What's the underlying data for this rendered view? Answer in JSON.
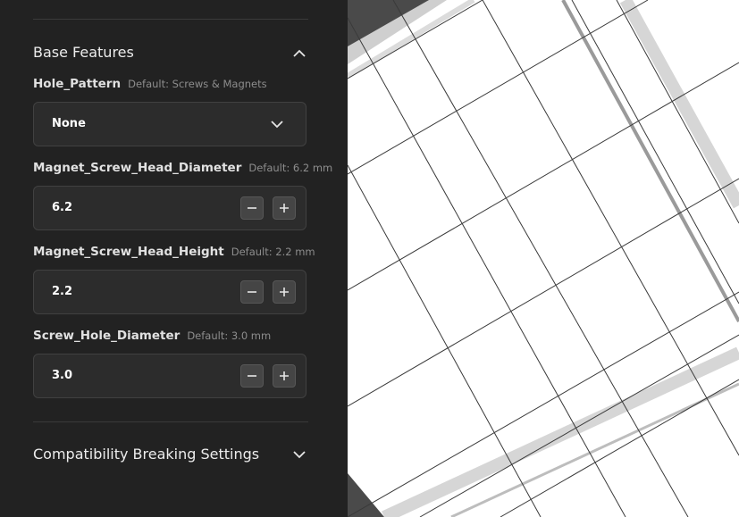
{
  "sections": {
    "base_features": {
      "title": "Base Features",
      "icon": "chevron-up-icon"
    },
    "compat": {
      "title": "Compatibility Breaking Settings",
      "icon": "chevron-down-icon"
    }
  },
  "params": {
    "hole_pattern": {
      "label": "Hole_Pattern",
      "default": "Default: Screws & Magnets",
      "value": "None",
      "icon": "chevron-down-icon"
    },
    "head_diameter": {
      "label": "Magnet_Screw_Head_Diameter",
      "default": "Default: 6.2 mm",
      "value": "6.2"
    },
    "head_height": {
      "label": "Magnet_Screw_Head_Height",
      "default": "Default: 2.2 mm",
      "value": "2.2"
    },
    "hole_diameter": {
      "label": "Screw_Hole_Diameter",
      "default": "Default: 3.0 mm",
      "value": "3.0"
    }
  },
  "stepper_icons": {
    "decrement": "minus-icon",
    "increment": "plus-icon"
  },
  "colors": {
    "panel_bg": "#222222",
    "field_bg": "#2c2c2c",
    "viewport_bg": "#ffffff",
    "grid_line": "#3a3a3a"
  }
}
